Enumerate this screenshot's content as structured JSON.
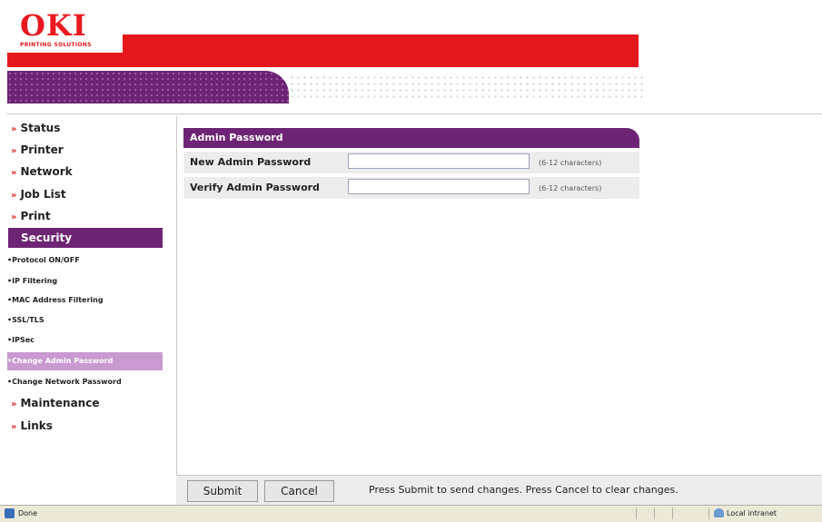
{
  "brand": {
    "name": "OKI",
    "tagline": "PRINTING SOLUTIONS",
    "red": "#e4171d",
    "purple": "#6e2474"
  },
  "sidebar": {
    "items": [
      {
        "label": "Status"
      },
      {
        "label": "Printer"
      },
      {
        "label": "Network"
      },
      {
        "label": "Job List"
      },
      {
        "label": "Print"
      },
      {
        "label": "Security"
      }
    ],
    "sub_items": [
      {
        "label": "•Protocol ON/OFF"
      },
      {
        "label": "•IP Filtering"
      },
      {
        "label": "•MAC Address Filtering"
      },
      {
        "label": "•SSL/TLS"
      },
      {
        "label": "•IPSec"
      },
      {
        "label": "•Change Admin Password"
      },
      {
        "label": "•Change Network Password"
      }
    ],
    "after_items": [
      {
        "label": "Maintenance"
      },
      {
        "label": "Links"
      }
    ],
    "chevron": "»"
  },
  "form": {
    "title": "Admin Password",
    "rows": [
      {
        "label": "New Admin Password",
        "value": "",
        "hint": "(6-12 characters)"
      },
      {
        "label": "Verify Admin Password",
        "value": "",
        "hint": "(6-12 characters)"
      }
    ]
  },
  "footer": {
    "submit_label": "Submit",
    "cancel_label": "Cancel",
    "message": "Press Submit to send changes. Press Cancel to clear changes."
  },
  "statusbar": {
    "left_text": "Done",
    "zone_text": "Local intranet"
  }
}
